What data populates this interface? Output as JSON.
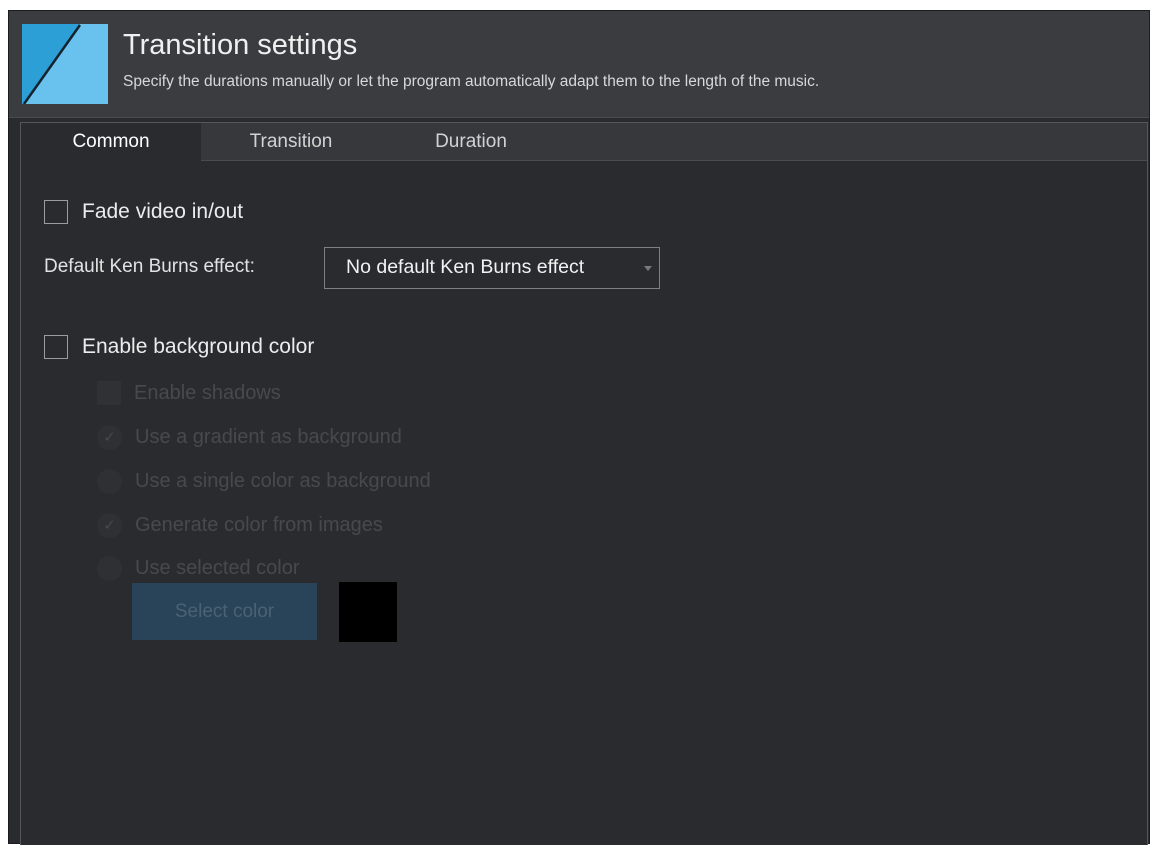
{
  "header": {
    "title": "Transition settings",
    "subtitle": "Specify the durations manually or let the program automatically adapt them to the length of the music."
  },
  "tabs": [
    {
      "label": "Common",
      "active": true
    },
    {
      "label": "Transition",
      "active": false
    },
    {
      "label": "Duration",
      "active": false
    }
  ],
  "common": {
    "fade_video": {
      "label": "Fade video in/out",
      "checked": false
    },
    "ken_burns": {
      "label": "Default Ken Burns effect:",
      "selected": "No default Ken Burns effect"
    },
    "background_color": {
      "label": "Enable background color",
      "checked": false
    },
    "enable_shadows": {
      "label": "Enable shadows",
      "enabled": false
    },
    "gradient_background": {
      "label": "Use a gradient as background",
      "selected": true,
      "enabled": false
    },
    "single_color_background": {
      "label": "Use a single color as background",
      "selected": false,
      "enabled": false
    },
    "generate_color": {
      "label": "Generate color from images",
      "selected": true,
      "enabled": false
    },
    "selected_color": {
      "label": "Use selected color",
      "selected": false,
      "enabled": false
    },
    "select_color_button": "Select color",
    "color_swatch_value": "#000000"
  },
  "colors": {
    "background": "#2a2b2f",
    "header": "#3b3c40",
    "accent": "#2c9fd6",
    "disabled_button": "#294459"
  },
  "icons": {
    "logo": "app-logo-icon",
    "dropdown": "chevron-down-icon",
    "check": "checkmark-icon"
  }
}
